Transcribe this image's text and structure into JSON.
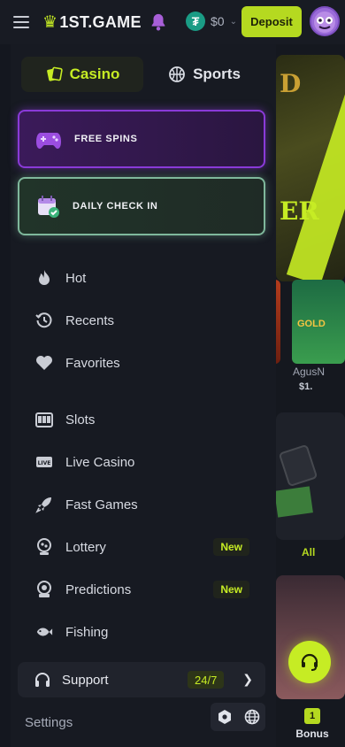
{
  "header": {
    "logo_text": "1ST.GAME",
    "balance": "$0",
    "deposit_label": "Deposit"
  },
  "drawer": {
    "tabs": [
      {
        "label": "Casino",
        "active": true
      },
      {
        "label": "Sports",
        "active": false
      }
    ],
    "promos": [
      {
        "label": "FREE SPINS"
      },
      {
        "label": "DAILY CHECK IN"
      }
    ],
    "nav_items": [
      {
        "label": "Hot",
        "icon": "fire-icon"
      },
      {
        "label": "Recents",
        "icon": "history-icon"
      },
      {
        "label": "Favorites",
        "icon": "heart-icon"
      },
      {
        "label": "Slots",
        "icon": "slot-machine-icon"
      },
      {
        "label": "Live Casino",
        "icon": "live-icon"
      },
      {
        "label": "Fast Games",
        "icon": "rocket-icon"
      },
      {
        "label": "Lottery",
        "icon": "lottery-icon",
        "badge": "New"
      },
      {
        "label": "Predictions",
        "icon": "crystal-ball-icon",
        "badge": "New"
      },
      {
        "label": "Fishing",
        "icon": "fish-icon"
      }
    ],
    "support": {
      "label": "Support",
      "badge": "24/7"
    },
    "settings_label": "Settings"
  },
  "background": {
    "game_name": "AgusN",
    "game_price": "$1.",
    "all_link": "All",
    "bonus_tab": "Bonus"
  },
  "colors": {
    "accent": "#c6ec24",
    "drawer_bg": "#171a22",
    "spins_border": "#8a3ad8",
    "checkin_border": "#7fb89c"
  }
}
